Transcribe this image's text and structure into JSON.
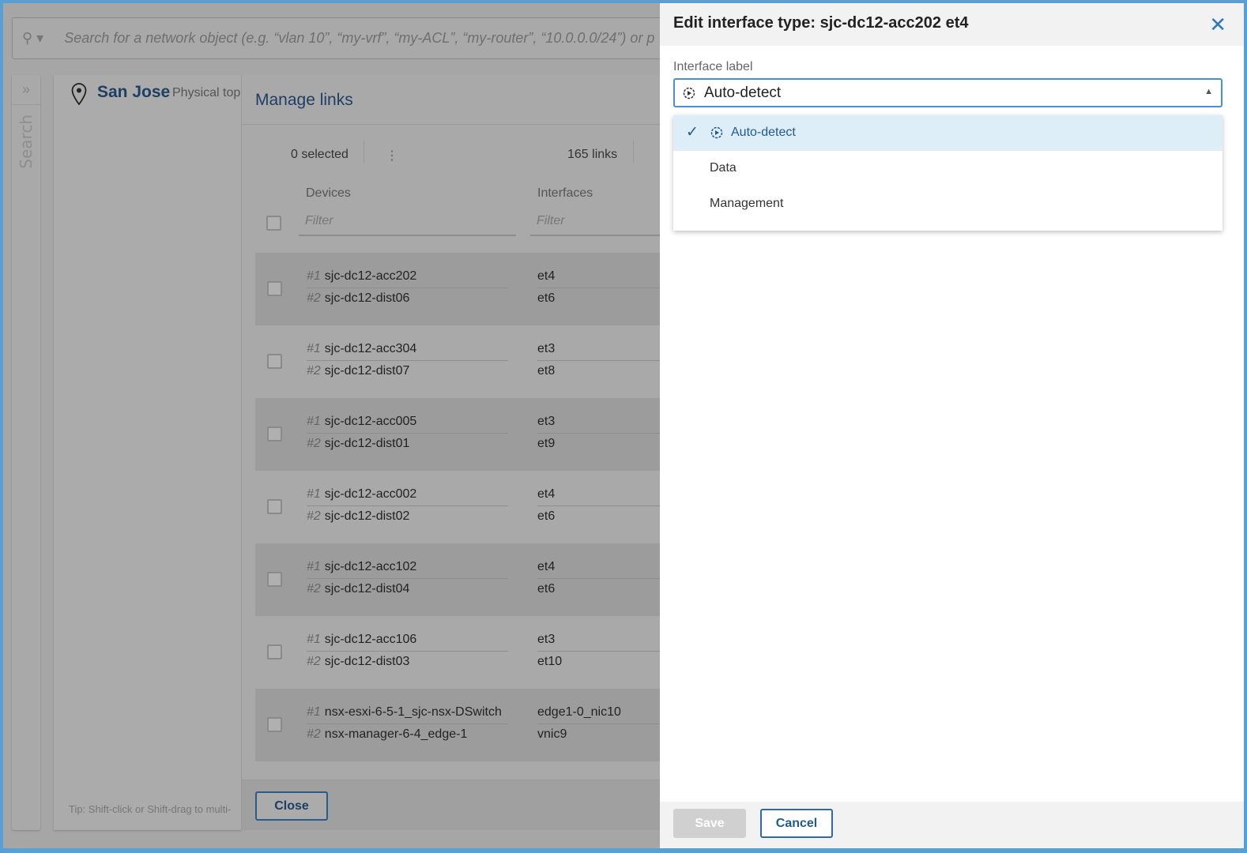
{
  "search": {
    "placeholder": "Search for a network object (e.g. “vlan 10”, “my-vrf”, “my-ACL”, “my-router”, “10.0.0.0/24”) or p"
  },
  "sidebar": {
    "label": "Search"
  },
  "location": {
    "title": "San Jose",
    "subtitle": "Physical top"
  },
  "manage_links": {
    "title": "Manage links",
    "selected": "0 selected",
    "count": "165 links",
    "columns": {
      "devices": "Devices",
      "interfaces": "Interfaces"
    },
    "filter_placeholder": "Filter",
    "rows": [
      {
        "d1": "sjc-dc12-acc202",
        "d2": "sjc-dc12-dist06",
        "i1": "et4",
        "i2": "et6"
      },
      {
        "d1": "sjc-dc12-acc304",
        "d2": "sjc-dc12-dist07",
        "i1": "et3",
        "i2": "et8"
      },
      {
        "d1": "sjc-dc12-acc005",
        "d2": "sjc-dc12-dist01",
        "i1": "et3",
        "i2": "et9"
      },
      {
        "d1": "sjc-dc12-acc002",
        "d2": "sjc-dc12-dist02",
        "i1": "et4",
        "i2": "et6"
      },
      {
        "d1": "sjc-dc12-acc102",
        "d2": "sjc-dc12-dist04",
        "i1": "et4",
        "i2": "et6"
      },
      {
        "d1": "sjc-dc12-acc106",
        "d2": "sjc-dc12-dist03",
        "i1": "et3",
        "i2": "et10"
      },
      {
        "d1": "nsx-esxi-6-5-1_sjc-nsx-DSwitch",
        "d2": "nsx-manager-6-4_edge-1",
        "i1": "edge1-0_nic10",
        "i2": "vnic9"
      }
    ],
    "num1": "#1",
    "num2": "#2",
    "close_label": "Close"
  },
  "tip": "Tip: Shift-click or Shift-drag to multi-",
  "dialog": {
    "title": "Edit interface type: sjc-dc12-acc202 et4",
    "field_label": "Interface label",
    "selected_value": "Auto-detect",
    "options": [
      "Auto-detect",
      "Data",
      "Management"
    ],
    "save_label": "Save",
    "cancel_label": "Cancel"
  },
  "colors": {
    "accent": "#2a7ac0",
    "selected_bg": "#ddeef9",
    "frame": "#5a9fd4"
  }
}
